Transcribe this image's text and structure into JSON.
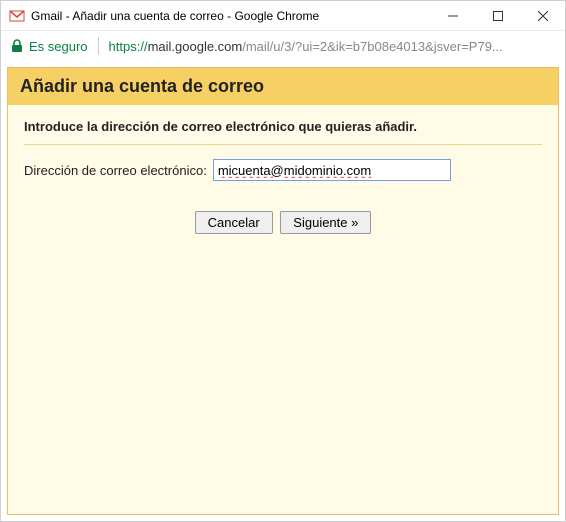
{
  "window": {
    "title": "Gmail - Añadir una cuenta de correo - Google Chrome"
  },
  "addressbar": {
    "secure_label": "Es seguro",
    "url_https": "https://",
    "url_host": "mail.google.com",
    "url_path": "/mail/u/3/?ui=2&ik=b7b08e4013&jsver=P79..."
  },
  "panel": {
    "header": "Añadir una cuenta de correo",
    "instruction": "Introduce la dirección de correo electrónico que quieras añadir.",
    "email_label": "Dirección de correo electrónico:",
    "email_value": "micuenta@midominio.com",
    "cancel_label": "Cancelar",
    "next_label": "Siguiente »"
  }
}
